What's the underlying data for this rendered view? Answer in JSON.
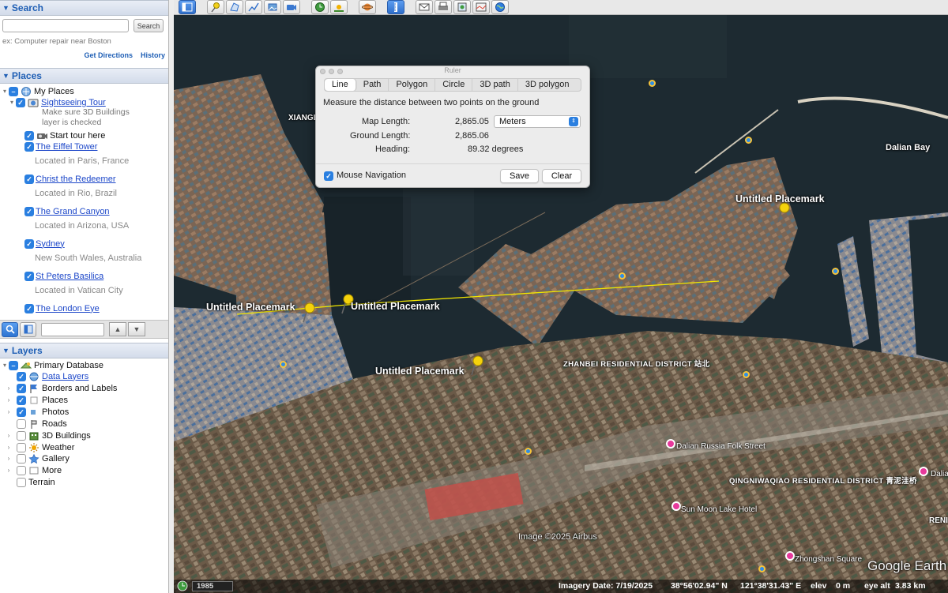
{
  "search": {
    "header": "Search",
    "placeholder": "",
    "button_label": "Search",
    "hint": "ex: Computer repair near Boston",
    "get_directions": "Get Directions",
    "history": "History"
  },
  "places": {
    "header": "Places",
    "my_places": "My Places",
    "tour": {
      "title": "Sightseeing Tour",
      "note_line1": "Make sure 3D Buildings",
      "note_line2": "layer is checked",
      "start": "Start tour here"
    },
    "items": [
      {
        "title": "The Eiffel Tower",
        "location": "Located in Paris, France"
      },
      {
        "title": "Christ the Redeemer",
        "location": "Located in Rio, Brazil"
      },
      {
        "title": "The Grand Canyon",
        "location": "Located in Arizona, USA"
      },
      {
        "title": "Sydney",
        "location": "New South Wales, Australia"
      },
      {
        "title": "St Peters Basilica",
        "location": "Located in Vatican City"
      },
      {
        "title": "The London Eye",
        "location": ""
      }
    ]
  },
  "layers": {
    "header": "Layers",
    "items": [
      {
        "label": "Primary Database",
        "checked": "mixed",
        "icon": "database-icon"
      },
      {
        "label": "Data Layers",
        "checked": true,
        "icon": "globe-layers-icon",
        "link": true
      },
      {
        "label": "Borders and Labels",
        "checked": true,
        "icon": "flag-icon"
      },
      {
        "label": "Places",
        "checked": true,
        "icon": "places-icon"
      },
      {
        "label": "Photos",
        "checked": true,
        "icon": "photo-icon"
      },
      {
        "label": "Roads",
        "checked": false,
        "icon": "road-icon"
      },
      {
        "label": "3D Buildings",
        "checked": false,
        "icon": "building-icon"
      },
      {
        "label": "Weather",
        "checked": false,
        "icon": "sun-icon"
      },
      {
        "label": "Gallery",
        "checked": false,
        "icon": "star-icon"
      },
      {
        "label": "More",
        "checked": false,
        "icon": "more-icon"
      },
      {
        "label": "Terrain",
        "checked": false,
        "icon": ""
      }
    ]
  },
  "ruler": {
    "title": "Ruler",
    "tabs": [
      "Line",
      "Path",
      "Polygon",
      "Circle",
      "3D path",
      "3D polygon"
    ],
    "active_tab": "Line",
    "description": "Measure the distance between two points on the ground",
    "map_length_label": "Map Length:",
    "map_length_value": "2,865.05",
    "unit": "Meters",
    "ground_length_label": "Ground Length:",
    "ground_length_value": "2,865.06",
    "heading_label": "Heading:",
    "heading_value": "89.32 degrees",
    "mouse_navigation": "Mouse Navigation",
    "save": "Save",
    "clear": "Clear"
  },
  "map_labels": {
    "placemark_1": "Untitled Placemark",
    "placemark_2": "Untitled Placemark",
    "placemark_3": "Untitled Placemark",
    "placemark_4": "Untitled Placemark",
    "xiangl": "XIANGL",
    "dalian_bay": "Dalian Bay",
    "zhanbei": "ZHANBEI RESIDENTIAL DISTRICT 站北",
    "russia_street": "Dalian Russia Folk Street",
    "qingniwaqiao": "QINGNIWAQIAO RESIDENTIAL DISTRICT 青泥洼桥",
    "dalian_edge": "Dalian",
    "sun_moon": "Sun Moon Lake Hotel",
    "zhongshan": "Zhongshan Square",
    "ren_edge": "RENI",
    "copyright": "Image ©2025 Airbus",
    "logo": "Google Earth"
  },
  "status": {
    "historical_year": "1985",
    "imagery_date": "Imagery Date: 7/19/2025",
    "lat": "38°56'02.94\" N",
    "lon": "121°38'31.43\" E",
    "elev_label": "elev",
    "elev_value": "0 m",
    "eye_alt_label": "eye alt",
    "eye_alt_value": "3.83 km"
  },
  "colors": {
    "accent": "#2a7fe0",
    "link": "#1c47c9",
    "ruler_line": "#f2e600",
    "placemark": "#f5d20c"
  }
}
